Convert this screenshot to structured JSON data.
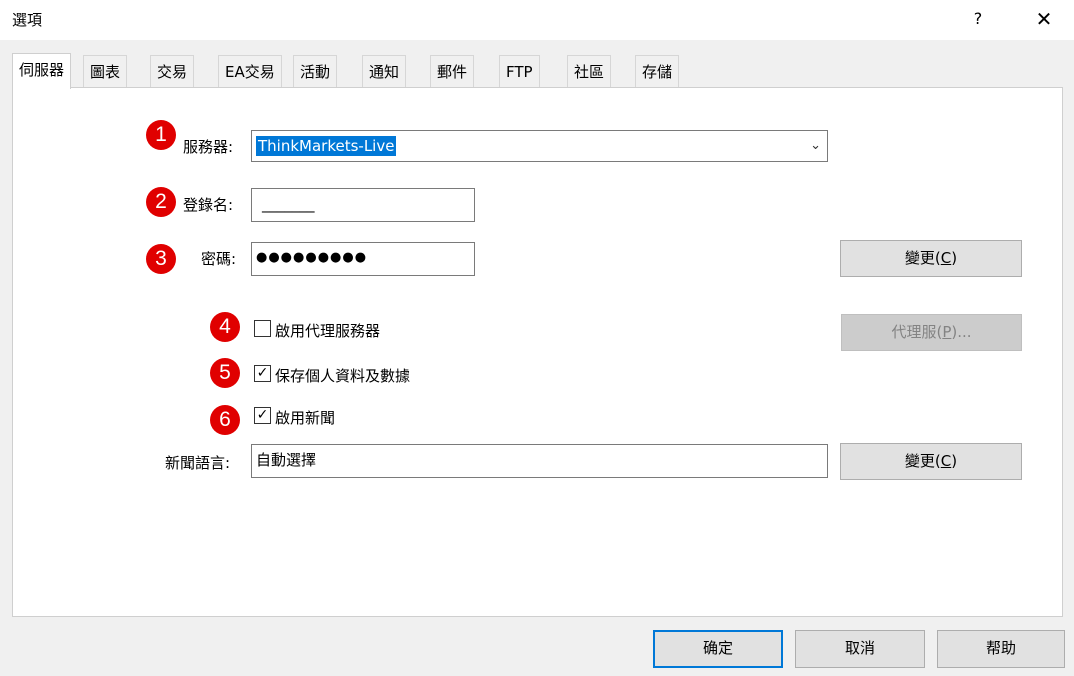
{
  "window": {
    "title": "選項",
    "help": "?",
    "close": "✕"
  },
  "tabs": [
    "伺服器",
    "圖表",
    "交易",
    "EA交易",
    "活動",
    "通知",
    "郵件",
    "FTP",
    "社區",
    "存儲"
  ],
  "form": {
    "server_label": "服務器:",
    "server_value": "ThinkMarkets-Live",
    "login_label": "登錄名:",
    "login_value": "_______",
    "password_label": "密碼:",
    "password_value": "●●●●●●●●●",
    "change_button_1": "變更(",
    "change_button_1_key": "C",
    "change_button_1_end": ")",
    "proxy_enable": "啟用代理服務器",
    "proxy_button": "代理服(",
    "proxy_button_key": "P",
    "proxy_button_end": ")...",
    "save_personal": "保存個人資料及數據",
    "enable_news": "啟用新聞",
    "news_lang_label": "新聞語言:",
    "news_lang_value": "自動選擇",
    "change_button_2": "變更(",
    "change_button_2_key": "C",
    "change_button_2_end": ")"
  },
  "badges": [
    "1",
    "2",
    "3",
    "4",
    "5",
    "6"
  ],
  "checks": {
    "proxy": "",
    "save": "✓",
    "news": "✓"
  },
  "footer": {
    "ok": "确定",
    "cancel": "取消",
    "help": "帮助"
  },
  "colors": {
    "badge": "#e00000",
    "selection": "#0078d7"
  }
}
